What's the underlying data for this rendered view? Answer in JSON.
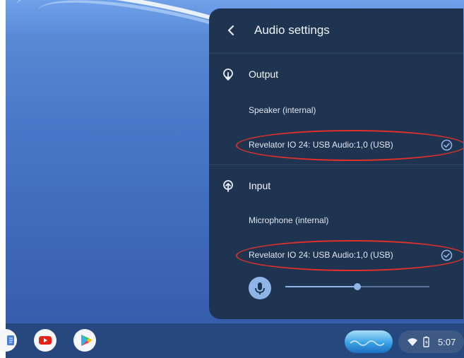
{
  "panel": {
    "title": "Audio settings",
    "output": {
      "label": "Output",
      "devices": [
        {
          "name": "Speaker (internal)",
          "selected": false
        },
        {
          "name": "Revelator IO 24: USB Audio:1,0 (USB)",
          "selected": true
        }
      ]
    },
    "input": {
      "label": "Input",
      "devices": [
        {
          "name": "Microphone (internal)",
          "selected": false
        },
        {
          "name": "Revelator IO 24: USB Audio:1,0 (USB)",
          "selected": true
        }
      ],
      "volume_level": 0.5
    }
  },
  "shelf": {
    "apps": [
      "files-icon",
      "youtube-icon",
      "play-store-icon"
    ],
    "status": {
      "time": "5:07",
      "icons": [
        "wifi-icon",
        "battery-icon"
      ]
    }
  },
  "colors": {
    "panel_bg": "#1f3450",
    "accent": "#8fb4e8",
    "highlight": "#e0302a",
    "youtube_red": "#e62117"
  }
}
